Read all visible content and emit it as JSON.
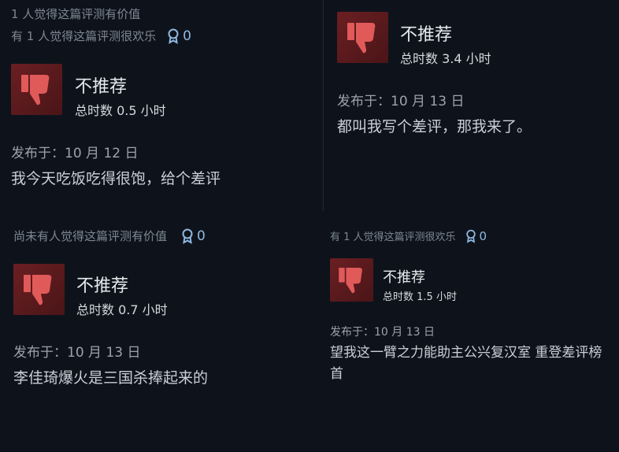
{
  "reviews": [
    {
      "helpful_text": "1 人觉得这篇评测有价值",
      "funny_text": "有 1 人觉得这篇评测很欢乐",
      "award_count": "0",
      "verdict": "不推荐",
      "hours": "总时数 0.5 小时",
      "posted": "发布于：10 月 12 日",
      "text": "我今天吃饭吃得很饱，给个差评"
    },
    {
      "verdict": "不推荐",
      "hours": "总时数 3.4 小时",
      "posted": "发布于：10 月 13 日",
      "text": "都叫我写个差评，那我来了。"
    },
    {
      "helpful_text": "尚未有人觉得这篇评测有价值",
      "award_count": "0",
      "verdict": "不推荐",
      "hours": "总时数 0.7 小时",
      "posted": "发布于：10 月 13 日",
      "text": "李佳琦爆火是三国杀捧起来的"
    },
    {
      "helpful_text": "有 1 人觉得这篇评测很欢乐",
      "award_count": "0",
      "verdict": "不推荐",
      "hours": "总时数 1.5 小时",
      "posted": "发布于：10 月 13 日",
      "text": "望我这一臂之力能助主公兴复汉室 重登差评榜首"
    }
  ],
  "icons": {
    "thumb": "thumbs-down-icon",
    "award": "award-ribbon-icon"
  },
  "colors": {
    "thumb_bg": "#6b1f22",
    "thumb_fg": "#e05a5a",
    "award": "#8fb8e0"
  }
}
